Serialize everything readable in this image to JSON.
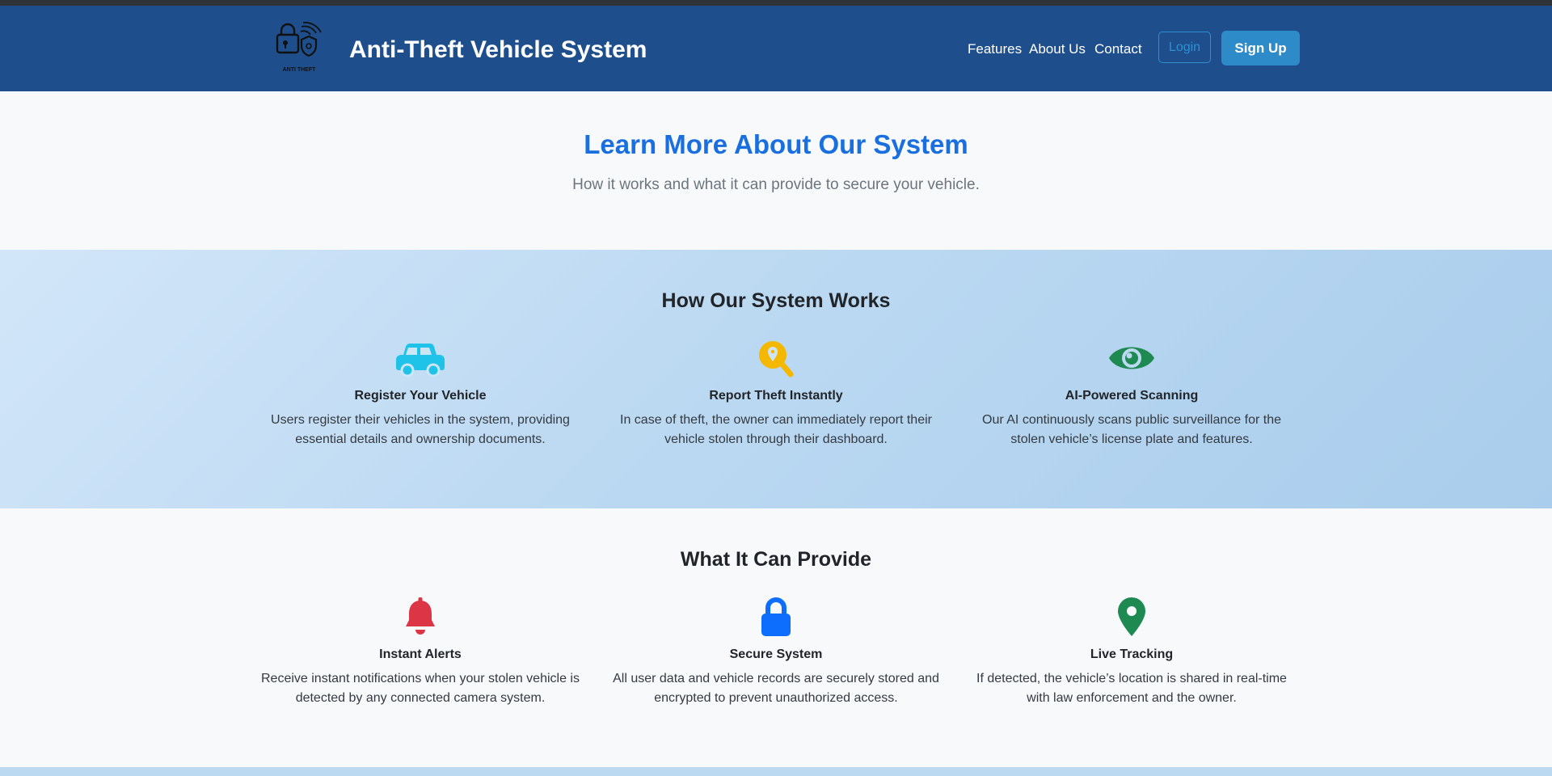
{
  "header": {
    "logo_text": "ANTI THEFT",
    "title": "Anti-Theft Vehicle System",
    "nav": [
      {
        "label": "Features"
      },
      {
        "label": "About Us"
      },
      {
        "label": "Contact"
      }
    ],
    "login_label": "Login",
    "signup_label": "Sign Up"
  },
  "hero": {
    "title": "Learn More About Our System",
    "subtitle": "How it works and what it can provide to secure your vehicle."
  },
  "works": {
    "title": "How Our System Works",
    "cards": [
      {
        "icon": "car-icon",
        "color": "#1fc2e8",
        "title": "Register Your Vehicle",
        "text": "Users register their vehicles in the system, providing essential details and ownership documents."
      },
      {
        "icon": "search-location-icon",
        "color": "#f5b800",
        "title": "Report Theft Instantly",
        "text": "In case of theft, the owner can immediately report their vehicle stolen through their dashboard."
      },
      {
        "icon": "eye-icon",
        "color": "#1e8a52",
        "title": "AI-Powered Scanning",
        "text": "Our AI continuously scans public surveillance for the stolen vehicle’s license plate and features."
      }
    ]
  },
  "provide": {
    "title": "What It Can Provide",
    "cards": [
      {
        "icon": "bell-icon",
        "color": "#dc3545",
        "title": "Instant Alerts",
        "text": "Receive instant notifications when your stolen vehicle is detected by any connected camera system."
      },
      {
        "icon": "lock-icon",
        "color": "#0d6efd",
        "title": "Secure System",
        "text": "All user data and vehicle records are securely stored and encrypted to prevent unauthorized access."
      },
      {
        "icon": "map-pin-icon",
        "color": "#1e8a52",
        "title": "Live Tracking",
        "text": "If detected, the vehicle’s location is shared in real-time with law enforcement and the owner."
      }
    ]
  }
}
